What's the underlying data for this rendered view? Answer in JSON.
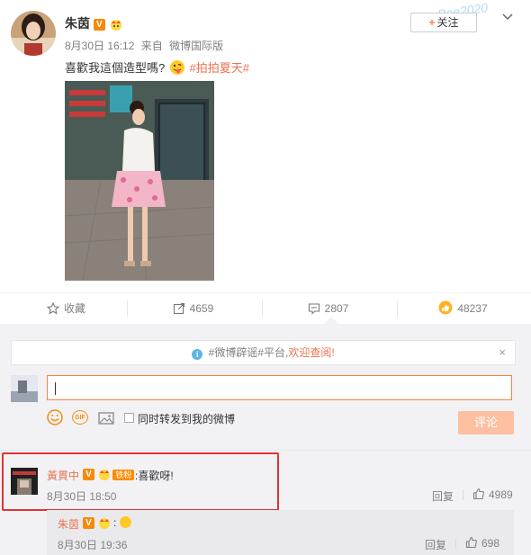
{
  "post": {
    "author": "朱茵",
    "date": "8月30日 16:12",
    "source_prefix": "来自",
    "source": "微博国际版",
    "text": "喜歡我這個造型嗎?",
    "hashtag": "#拍拍夏天#",
    "follow_label": "关注",
    "watermark": "Bee2020"
  },
  "actions": {
    "favorite_label": "收藏",
    "repost_count": "4659",
    "comment_count": "2807",
    "like_count": "48237"
  },
  "notice": {
    "text": "#微博辟谣#平台,",
    "link": "欢迎查阅!",
    "close": "×"
  },
  "composer": {
    "repost_label": "同时转发到我的微博",
    "submit_label": "评论",
    "gif_label": "GIF"
  },
  "badges": {
    "v": "V",
    "fan": "铁粉"
  },
  "comment1": {
    "name": "黃貫中",
    "text": ":喜歡呀!",
    "time": "8月30日 18:50",
    "reply_label": "回复",
    "likes": "4989"
  },
  "reply1": {
    "name": "朱茵",
    "colon": ":",
    "time": "8月30日 19:36",
    "reply_label": "回复",
    "likes": "698"
  },
  "colors": {
    "accent": "#eb7350",
    "vip": "#f78a06",
    "highlight_border": "#e23232",
    "background_gray": "#f2f2f5"
  },
  "icons": [
    "avatar",
    "v-badge",
    "crown-badge",
    "tongue-emoji",
    "star-icon",
    "repost-icon",
    "comment-icon",
    "like-icon",
    "info-icon",
    "smile-icon",
    "gif-icon",
    "image-icon",
    "chevron-down-icon"
  ]
}
